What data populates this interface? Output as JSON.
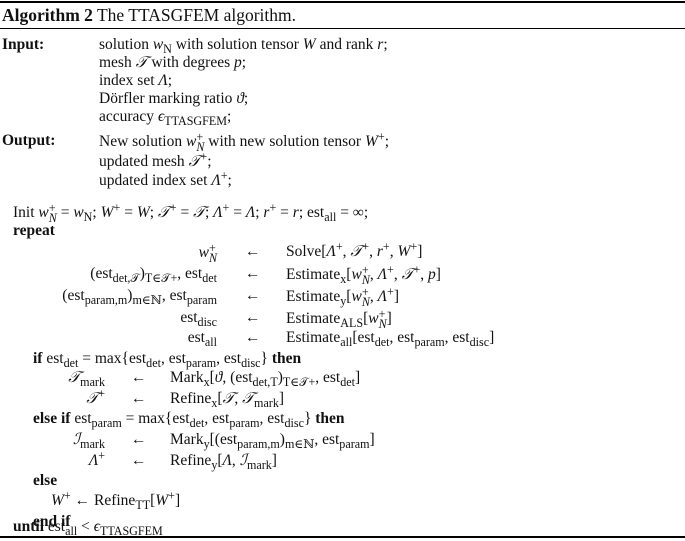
{
  "caption": {
    "label": "Algorithm 2",
    "title": " The TTASGFEM algorithm."
  },
  "input": {
    "label": "Input:",
    "lines": [
      [
        {
          "t": "solution "
        },
        {
          "i": "w"
        },
        {
          "sub": "N"
        },
        {
          "t": " with solution tensor "
        },
        {
          "i": "W"
        },
        {
          "t": " and rank "
        },
        {
          "i": "r"
        },
        {
          "t": ";"
        }
      ],
      [
        {
          "t": "mesh "
        },
        {
          "i": "𝒯"
        },
        {
          "t": " with degrees "
        },
        {
          "i": "p"
        },
        {
          "t": ";"
        }
      ],
      [
        {
          "t": "index set "
        },
        {
          "i": "Λ"
        },
        {
          "t": ";"
        }
      ],
      [
        {
          "t": "Dörfler marking ratio "
        },
        {
          "i": "ϑ"
        },
        {
          "t": ";"
        }
      ],
      [
        {
          "t": "accuracy "
        },
        {
          "i": "ϵ"
        },
        {
          "sub": "TTASGFEM"
        },
        {
          "t": ";"
        }
      ]
    ]
  },
  "output": {
    "label": "Output:",
    "lines": [
      [
        {
          "t": "New solution "
        },
        {
          "i": "w"
        },
        {
          "supsub": [
            "+",
            "N"
          ]
        },
        {
          "t": " with new solution tensor "
        },
        {
          "i": "W"
        },
        {
          "sup": "+"
        },
        {
          "t": ";"
        }
      ],
      [
        {
          "t": "updated mesh "
        },
        {
          "i": "𝒯"
        },
        {
          "sup": "+"
        },
        {
          "t": ";"
        }
      ],
      [
        {
          "t": "updated index set "
        },
        {
          "i": "Λ"
        },
        {
          "sup": "+"
        },
        {
          "t": ";"
        }
      ]
    ]
  },
  "init": [
    {
      "t": "Init "
    },
    {
      "i": "w"
    },
    {
      "supsub": [
        "+",
        "N"
      ]
    },
    {
      "t": " = "
    },
    {
      "i": "w"
    },
    {
      "sub": "N"
    },
    {
      "t": ";    "
    },
    {
      "i": "W"
    },
    {
      "sup": "+"
    },
    {
      "t": " = "
    },
    {
      "i": "W"
    },
    {
      "t": ";    "
    },
    {
      "i": "𝒯"
    },
    {
      "sup": "+"
    },
    {
      "t": " = "
    },
    {
      "i": "𝒯"
    },
    {
      "t": ";    "
    },
    {
      "i": "Λ"
    },
    {
      "sup": "+"
    },
    {
      "t": " = "
    },
    {
      "i": "Λ"
    },
    {
      "t": ";    "
    },
    {
      "i": "r"
    },
    {
      "sup": "+"
    },
    {
      "t": " = "
    },
    {
      "i": "r"
    },
    {
      "t": ";    est"
    },
    {
      "sub": "all"
    },
    {
      "t": " = ∞;"
    }
  ],
  "keywords": {
    "repeat": "repeat",
    "if": "if",
    "then": "then",
    "else_if": "else if",
    "else": "else",
    "end_if": "end if",
    "until": "until"
  },
  "arrow": "←",
  "repeat_block": [
    {
      "lhs": [
        {
          "i": "w"
        },
        {
          "supsub": [
            "+",
            "N"
          ]
        }
      ],
      "rhs": [
        {
          "t": "Solve["
        },
        {
          "i": "Λ"
        },
        {
          "sup": "+"
        },
        {
          "t": ", "
        },
        {
          "i": "𝒯"
        },
        {
          "sup": "+"
        },
        {
          "t": ", "
        },
        {
          "i": "r"
        },
        {
          "sup": "+"
        },
        {
          "t": ", "
        },
        {
          "i": "W"
        },
        {
          "sup": "+"
        },
        {
          "t": "]"
        }
      ]
    },
    {
      "lhs": [
        {
          "t": "(est"
        },
        {
          "sub": "det,𝒯"
        },
        {
          "t": ")"
        },
        {
          "sub": "T∈𝒯+"
        },
        {
          "t": ", est"
        },
        {
          "sub": "det"
        }
      ],
      "rhs": [
        {
          "t": "Estimate"
        },
        {
          "sub": "x"
        },
        {
          "t": "["
        },
        {
          "i": "w"
        },
        {
          "supsub": [
            "+",
            "N"
          ]
        },
        {
          "t": ", "
        },
        {
          "i": "Λ"
        },
        {
          "sup": "+"
        },
        {
          "t": ", "
        },
        {
          "i": "𝒯"
        },
        {
          "sup": "+"
        },
        {
          "t": ", "
        },
        {
          "i": "p"
        },
        {
          "t": "]"
        }
      ]
    },
    {
      "lhs": [
        {
          "t": "(est"
        },
        {
          "sub": "param,m"
        },
        {
          "t": ")"
        },
        {
          "sub": "m∈ℕ"
        },
        {
          "t": ", est"
        },
        {
          "sub": "param"
        }
      ],
      "rhs": [
        {
          "t": "Estimate"
        },
        {
          "sub": "y"
        },
        {
          "t": "["
        },
        {
          "i": "w"
        },
        {
          "supsub": [
            "+",
            "N"
          ]
        },
        {
          "t": ", "
        },
        {
          "i": "Λ"
        },
        {
          "sup": "+"
        },
        {
          "t": "]"
        }
      ]
    },
    {
      "lhs": [
        {
          "t": "est"
        },
        {
          "sub": "disc"
        }
      ],
      "rhs": [
        {
          "t": "Estimate"
        },
        {
          "sub": "ALS"
        },
        {
          "t": "["
        },
        {
          "i": "w"
        },
        {
          "supsub": [
            "+",
            "N"
          ]
        },
        {
          "t": "]"
        }
      ]
    },
    {
      "lhs": [
        {
          "t": "est"
        },
        {
          "sub": "all"
        }
      ],
      "rhs": [
        {
          "t": "Estimate"
        },
        {
          "sub": "all"
        },
        {
          "t": "[est"
        },
        {
          "sub": "det"
        },
        {
          "t": ", est"
        },
        {
          "sub": "param"
        },
        {
          "t": ", est"
        },
        {
          "sub": "disc"
        },
        {
          "t": "]"
        }
      ]
    }
  ],
  "if_cond": [
    {
      "t": " est"
    },
    {
      "sub": "det"
    },
    {
      "t": " = max{est"
    },
    {
      "sub": "det"
    },
    {
      "t": ", est"
    },
    {
      "sub": "param"
    },
    {
      "t": ", est"
    },
    {
      "sub": "disc"
    },
    {
      "t": "} "
    }
  ],
  "if_block": [
    {
      "lhs": [
        {
          "i": "𝒯"
        },
        {
          "sub": "mark"
        }
      ],
      "rhs": [
        {
          "t": "Mark"
        },
        {
          "sub": "x"
        },
        {
          "t": "["
        },
        {
          "i": "ϑ"
        },
        {
          "t": ", (est"
        },
        {
          "sub": "det,T"
        },
        {
          "t": ")"
        },
        {
          "sub": "T∈𝒯+"
        },
        {
          "t": ", est"
        },
        {
          "sub": "det"
        },
        {
          "t": "]"
        }
      ]
    },
    {
      "lhs": [
        {
          "i": "𝒯"
        },
        {
          "sup": "+"
        }
      ],
      "rhs": [
        {
          "t": "Refine"
        },
        {
          "sub": "x"
        },
        {
          "t": "["
        },
        {
          "i": "𝒯"
        },
        {
          "t": ", "
        },
        {
          "i": "𝒯"
        },
        {
          "sub": "mark"
        },
        {
          "t": "]"
        }
      ]
    }
  ],
  "elseif_cond": [
    {
      "t": " est"
    },
    {
      "sub": "param"
    },
    {
      "t": " = max{est"
    },
    {
      "sub": "det"
    },
    {
      "t": ", est"
    },
    {
      "sub": "param"
    },
    {
      "t": ", est"
    },
    {
      "sub": "disc"
    },
    {
      "t": "} "
    }
  ],
  "elseif_block": [
    {
      "lhs": [
        {
          "i": "ℐ"
        },
        {
          "sub": "mark"
        }
      ],
      "rhs": [
        {
          "t": "Mark"
        },
        {
          "sub": "y"
        },
        {
          "t": "[(est"
        },
        {
          "sub": "param,m"
        },
        {
          "t": ")"
        },
        {
          "sub": "m∈ℕ"
        },
        {
          "t": ", est"
        },
        {
          "sub": "param"
        },
        {
          "t": "]"
        }
      ]
    },
    {
      "lhs": [
        {
          "i": "Λ"
        },
        {
          "sup": "+"
        }
      ],
      "rhs": [
        {
          "t": "Refine"
        },
        {
          "sub": "y"
        },
        {
          "t": "["
        },
        {
          "i": "Λ"
        },
        {
          "t": ", "
        },
        {
          "i": "ℐ"
        },
        {
          "sub": "mark"
        },
        {
          "t": "]"
        }
      ]
    }
  ],
  "else_line": [
    {
      "i": "W"
    },
    {
      "sup": "+"
    },
    {
      "t": " ← Refine"
    },
    {
      "sub": "TT"
    },
    {
      "t": "["
    },
    {
      "i": "W"
    },
    {
      "sup": "+"
    },
    {
      "t": "]"
    }
  ],
  "until_cond": [
    {
      "t": " est"
    },
    {
      "sub": "all"
    },
    {
      "t": " < "
    },
    {
      "i": "ϵ"
    },
    {
      "sub": "TTASGFEM"
    }
  ]
}
